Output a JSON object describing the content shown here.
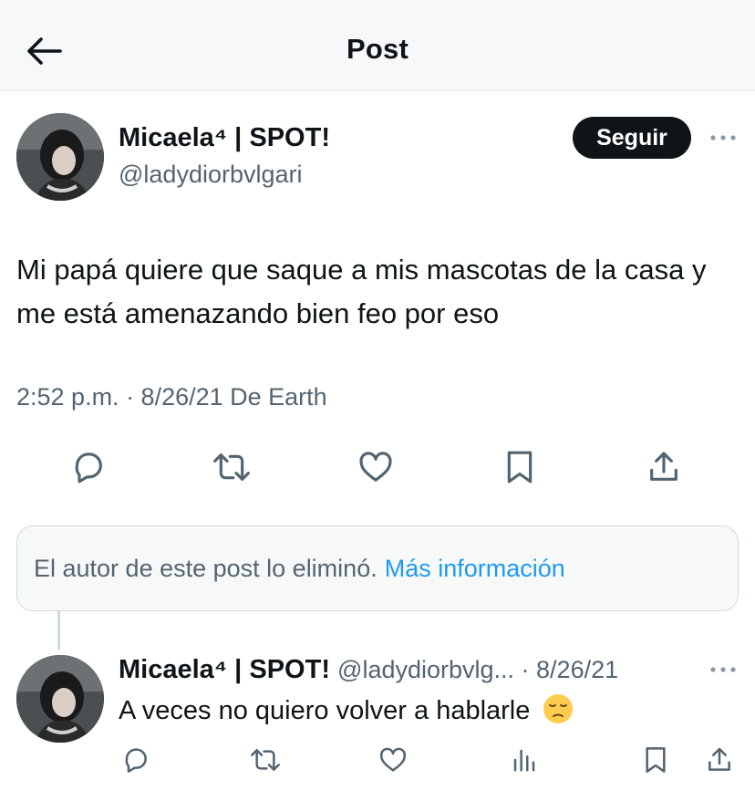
{
  "header": {
    "title": "Post",
    "back_icon": "arrow-left-icon"
  },
  "tweet": {
    "author_name": "Micaela⁴ | SPOT!",
    "author_handle": "@ladydiorbvlgari",
    "follow_label": "Seguir",
    "text": "Mi papá quiere que saque a mis mascotas de la casa y me está amenazando bien feo por eso",
    "meta": "2:52 p.m. · 8/26/21 De Earth",
    "actions": [
      "reply-icon",
      "retweet-icon",
      "like-icon",
      "bookmark-icon",
      "share-icon"
    ]
  },
  "deleted_notice": {
    "text": "El autor de este post lo eliminó.",
    "link": "Más información",
    "link_color": "#1d9bf0"
  },
  "reply": {
    "author_name": "Micaela⁴ | SPOT!",
    "meta": "@ladydiorbvlg... · 8/26/21",
    "text": "A veces no quiero volver a hablarle",
    "emoji": "pensive-face",
    "actions": [
      "reply-icon",
      "retweet-icon",
      "like-icon",
      "views-icon",
      "bookmark-icon",
      "share-icon"
    ]
  },
  "colors": {
    "text": "#0f1419",
    "secondary": "#536471",
    "button_bg": "#0f1419"
  }
}
